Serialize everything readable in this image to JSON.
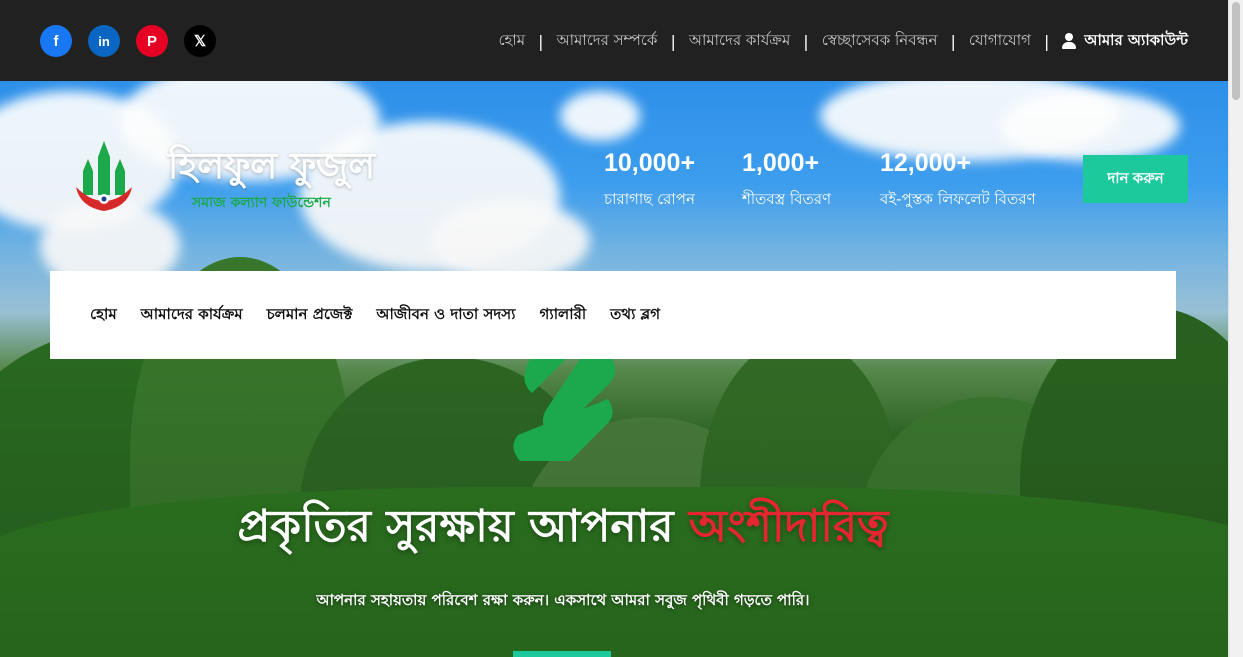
{
  "social": [
    {
      "name": "facebook-icon",
      "glyph": "f"
    },
    {
      "name": "linkedin-icon",
      "glyph": "in"
    },
    {
      "name": "pinterest-icon",
      "glyph": "P"
    },
    {
      "name": "x-icon",
      "glyph": "𝕏"
    }
  ],
  "topnav": {
    "items": [
      "হোম",
      "আমাদের সম্পর্কে",
      "আমাদের কার্যক্রম",
      "স্বেচ্ছাসেবক নিবন্ধন",
      "যোগাযোগ"
    ],
    "separator": "|",
    "account": "আমার অ্যাকাউন্ট"
  },
  "brand": {
    "name": "হিলফুল ফুজুল",
    "tagline": "সমাজ কল্যাণ ফাউন্ডেশন"
  },
  "stats": [
    {
      "value": "10,000+",
      "label": "চারাগাছ রোপন"
    },
    {
      "value": "1,000+",
      "label": "শীতবস্ত্র বিতরণ"
    },
    {
      "value": "12,000+",
      "label": "বই-পুস্তক লিফলেট বিতরণ"
    }
  ],
  "donate_label": "দান করুন",
  "mainnav": [
    "হোম",
    "আমাদের কার্যক্রম",
    "চলমান প্রজেক্ট",
    "আজীবন ও দাতা সদস্য",
    "গ্যালারী",
    "তথ্য ব্লগ"
  ],
  "hero": {
    "headline": "প্রকৃতির সুরক্ষায় আপনার",
    "headline_accent": "অংশীদারিত্ব",
    "subline": "আপনার সহায়তায় পরিবেশ রক্ষা করুন। একসাথে আমরা সবুজ পৃথিবী গড়তে পারি।"
  },
  "colors": {
    "topbar": "#212121",
    "accent_green": "#1cc99c",
    "brand_green": "#1ba94c",
    "headline_red": "#e3262f"
  }
}
